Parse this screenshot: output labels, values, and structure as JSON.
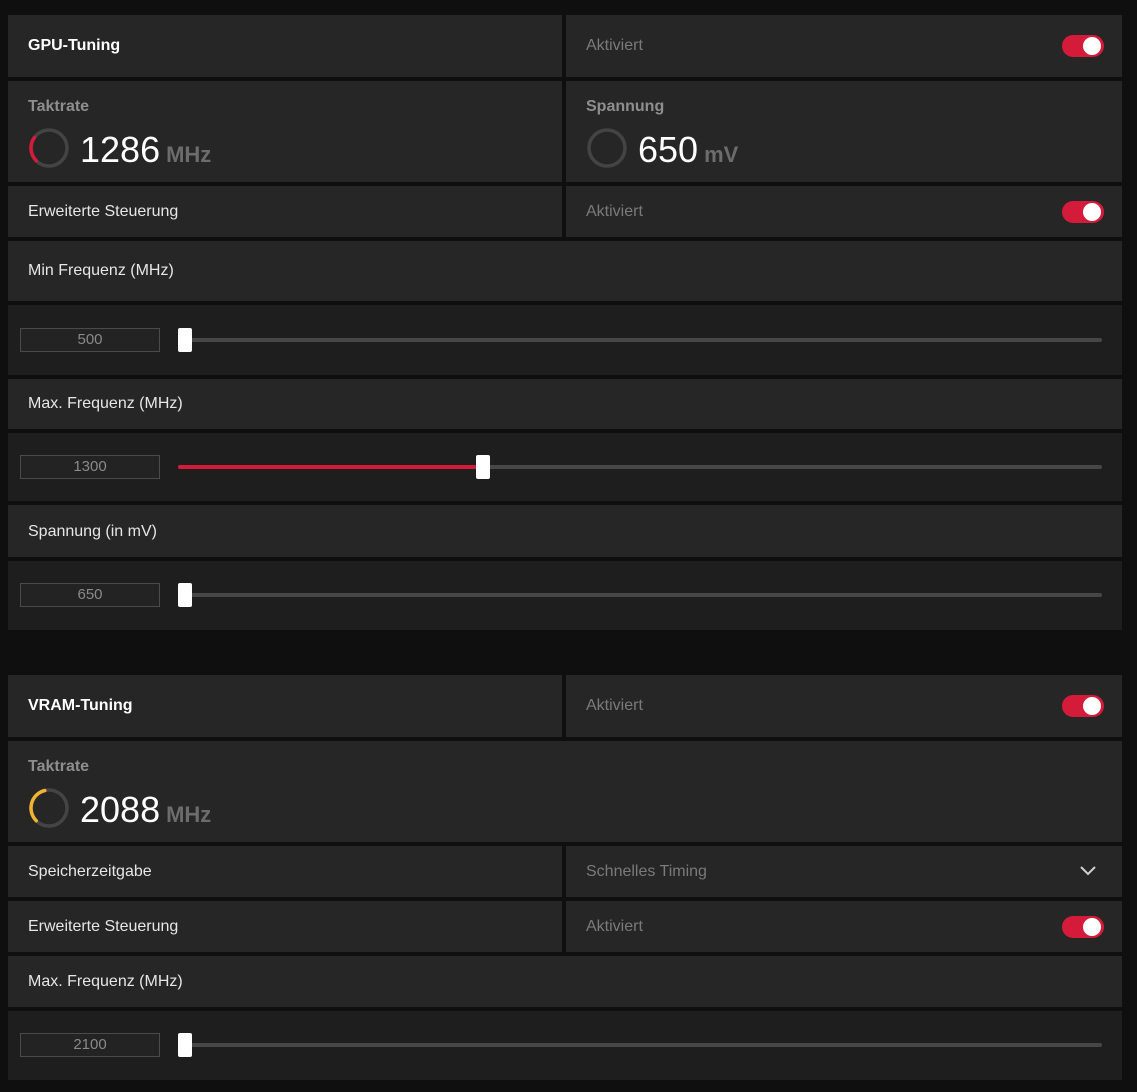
{
  "gpu": {
    "title": "GPU-Tuning",
    "status": "Aktiviert",
    "clock": {
      "label": "Taktrate",
      "value": "1286",
      "unit": "MHz",
      "gauge_fraction": 0.3,
      "gauge_color": "#d51b3a"
    },
    "voltage": {
      "label": "Spannung",
      "value": "650",
      "unit": "mV",
      "gauge_fraction": 0.0,
      "gauge_color": "#d51b3a"
    },
    "advanced": {
      "label": "Erweiterte Steuerung",
      "status": "Aktiviert"
    },
    "min_freq": {
      "label": "Min Frequenz (MHz)",
      "value": "500",
      "fraction": 0.0
    },
    "max_freq": {
      "label": "Max. Frequenz (MHz)",
      "value": "1300",
      "fraction": 0.323
    },
    "voltage_setting": {
      "label": "Spannung (in mV)",
      "value": "650",
      "fraction": 0.0
    }
  },
  "vram": {
    "title": "VRAM-Tuning",
    "status": "Aktiviert",
    "clock": {
      "label": "Taktrate",
      "value": "2088",
      "unit": "MHz",
      "gauge_fraction": 0.45,
      "gauge_color": "#f0b232"
    },
    "timing": {
      "label": "Speicherzeitgabe",
      "value": "Schnelles Timing"
    },
    "advanced": {
      "label": "Erweiterte Steuerung",
      "status": "Aktiviert"
    },
    "max_freq": {
      "label": "Max. Frequenz (MHz)",
      "value": "2100",
      "fraction": 0.0
    }
  },
  "colors": {
    "accent": "#d51b3a",
    "vram_gauge": "#f0b232",
    "panel": "#262626"
  },
  "icons": {
    "toggle": "toggle-switch-on",
    "dropdown": "chevron-down-icon"
  }
}
